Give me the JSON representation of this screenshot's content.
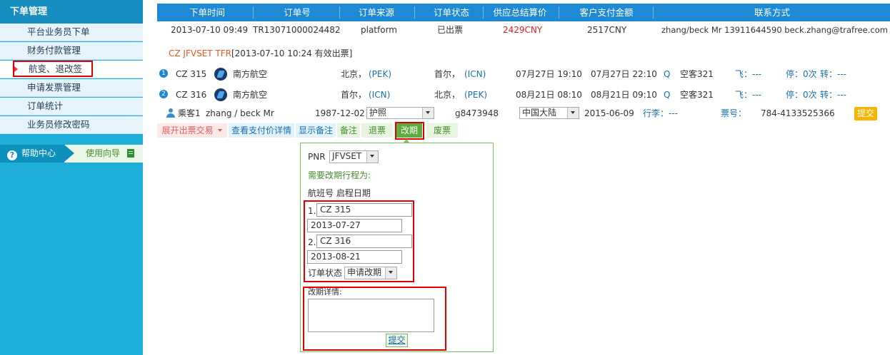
{
  "sidebar": {
    "title": "下单管理",
    "items": [
      {
        "label": "平台业务员下单"
      },
      {
        "label": "财务付款管理"
      },
      {
        "label": "航变、退改签"
      },
      {
        "label": "申请发票管理"
      },
      {
        "label": "订单统计"
      },
      {
        "label": "业务员修改密码"
      }
    ],
    "help_center": "帮助中心",
    "usage_guide": "使用向导"
  },
  "table": {
    "headers": [
      "下单时间",
      "订单号",
      "订单来源",
      "订单状态",
      "供应总结算价",
      "客户支付金额",
      "联系方式"
    ],
    "order": {
      "time": "2013-07-10 09:49",
      "order_no": "TR13071000024482",
      "source": "platform",
      "status": "已出票",
      "supply_price": "2429CNY",
      "customer_paid": "2517CNY",
      "contact": "zhang/beck Mr  13911644590  beck.zhang@trafree.com"
    }
  },
  "pnr_line": {
    "code": "CZ JFVSET TFR",
    "note": "[2013-07-10 10:24 有效出票]"
  },
  "flights": [
    {
      "index": "1",
      "flight_no": "CZ 315",
      "airline": "南方航空",
      "from_city": "北京，",
      "from_code": "(PEK)",
      "to_city": "首尔，",
      "to_code": "(ICN)",
      "depart": "07月27日 19:10",
      "arrive": "07月27日 22:10",
      "cabin_class": "Q",
      "aircraft": "空客321",
      "fly_label": "飞：---",
      "stop_label": "停：0次",
      "transfer_label": "转：---"
    },
    {
      "index": "2",
      "flight_no": "CZ 316",
      "airline": "南方航空",
      "from_city": "首尔，",
      "from_code": "(ICN)",
      "to_city": "北京，",
      "to_code": "(PEK)",
      "depart": "08月21日 08:10",
      "arrive": "08月21日 09:10",
      "cabin_class": "Q",
      "aircraft": "空客321",
      "fly_label": "飞：---",
      "stop_label": "停：0次",
      "transfer_label": "转：---"
    }
  ],
  "passenger": {
    "label": "乘客1",
    "name": "zhang / beck Mr",
    "birthday": "1987-12-02",
    "doc_type": "护照",
    "doc_no": "g8473948",
    "nationality": "中国大陆",
    "expiry": "2015-06-09",
    "luggage": "行李：---",
    "ticket_label": "票号：",
    "ticket_no": "784-4133525366",
    "submit": "提交"
  },
  "actions": {
    "expand": "展开出票交易",
    "view_pay": "查看支付价详情",
    "show_note": "显示备注",
    "note": "备注",
    "refund": "退票",
    "change": "改期",
    "void": "废票"
  },
  "change_form": {
    "pnr_label": "PNR",
    "pnr_value": "JFVSET",
    "itinerary_label": "需要改期行程为:",
    "cols_label": "航班号 启程日期",
    "seg1_index": "1.",
    "seg1_flight": "CZ 315",
    "seg1_date": "2013-07-27",
    "seg2_index": "2.",
    "seg2_flight": "CZ 316",
    "seg2_date": "2013-08-21",
    "status_label": "订单状态",
    "status_value": "申请改期",
    "detail_label": "改期详情:",
    "submit": "提交"
  },
  "colors": {
    "header_blue": "#1e8ad6",
    "sidebar_blue": "#1eaed8",
    "highlight_red": "#e00000",
    "submit_orange": "#f4b400"
  }
}
